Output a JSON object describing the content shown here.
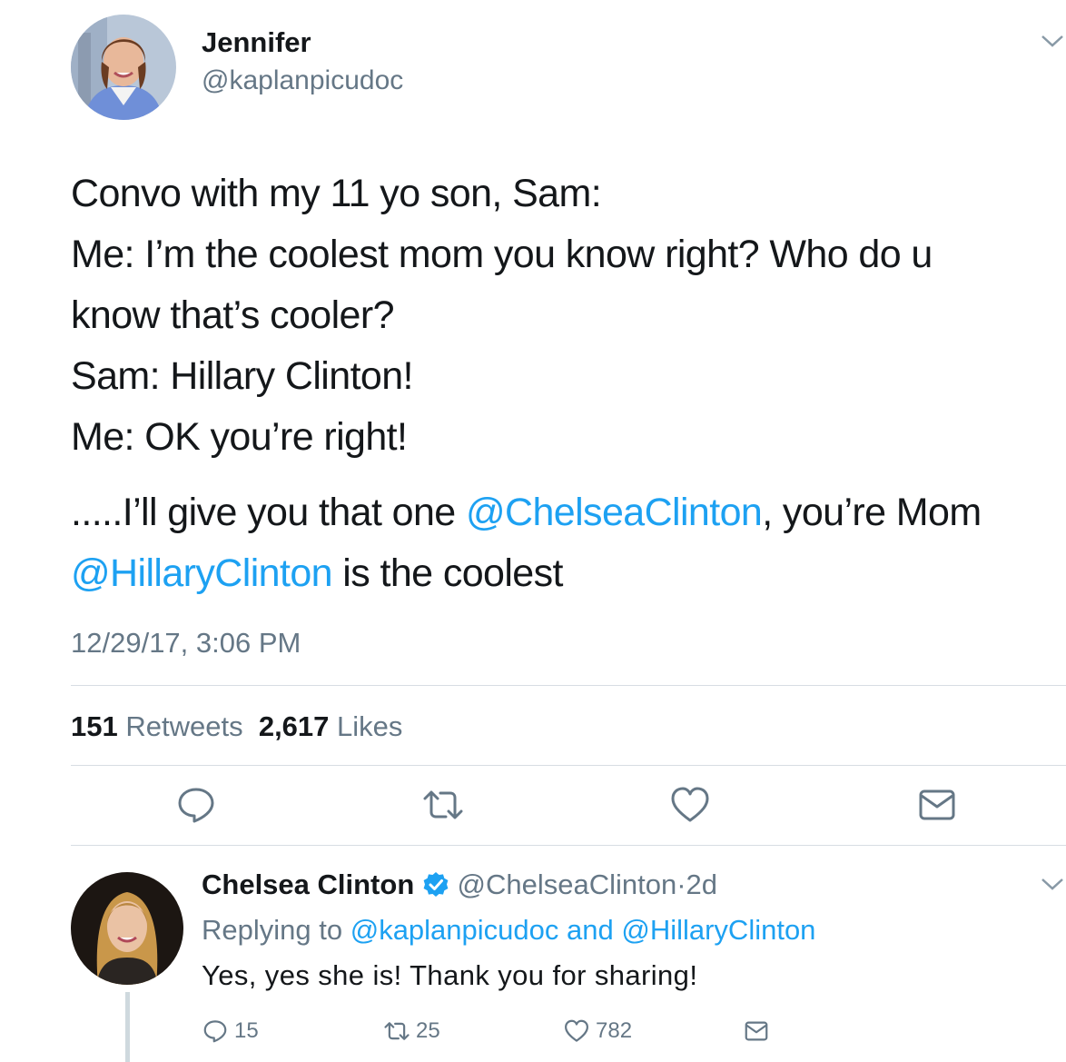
{
  "tweet": {
    "author_name": "Jennifer",
    "author_handle": "@kaplanpicudoc",
    "text_lines": [
      "Convo with my 11 yo son, Sam:",
      "Me: I’m the coolest mom you know right? Who do u",
      "know that’s cooler?",
      "Sam: Hillary Clinton!",
      "Me: OK you’re right!"
    ],
    "line6_pre": ".....I’ll give you that one ",
    "mention1": "@ChelseaClinton",
    "line6_post": ", you’re Mom",
    "mention2": "@HillaryClinton",
    "line7_post": " is the coolest",
    "timestamp": "12/29/17, 3:06 PM",
    "retweets_count": "151",
    "retweets_label": "Retweets",
    "likes_count": "2,617",
    "likes_label": "Likes",
    "actions": {
      "reply_icon": "reply-bubble-icon",
      "retweet_icon": "retweet-icon",
      "like_icon": "heart-icon",
      "dm_icon": "envelope-icon"
    }
  },
  "reply": {
    "author_name": "Chelsea Clinton",
    "verified_icon": "verified-badge-icon",
    "author_handle": "@ChelseaClinton",
    "separator": "·",
    "age": "2d",
    "replying_prefix": "Replying to ",
    "replying_mention1": "@kaplanpicudoc",
    "replying_and": " and ",
    "replying_mention2": "@HillaryClinton",
    "text": "Yes, yes she is! Thank you for sharing!",
    "reply_count": "15",
    "retweet_count": "25",
    "like_count": "782"
  },
  "colors": {
    "link": "#1da1f2",
    "grey": "#657786",
    "text": "#14171a",
    "divider": "#d7dde3"
  }
}
